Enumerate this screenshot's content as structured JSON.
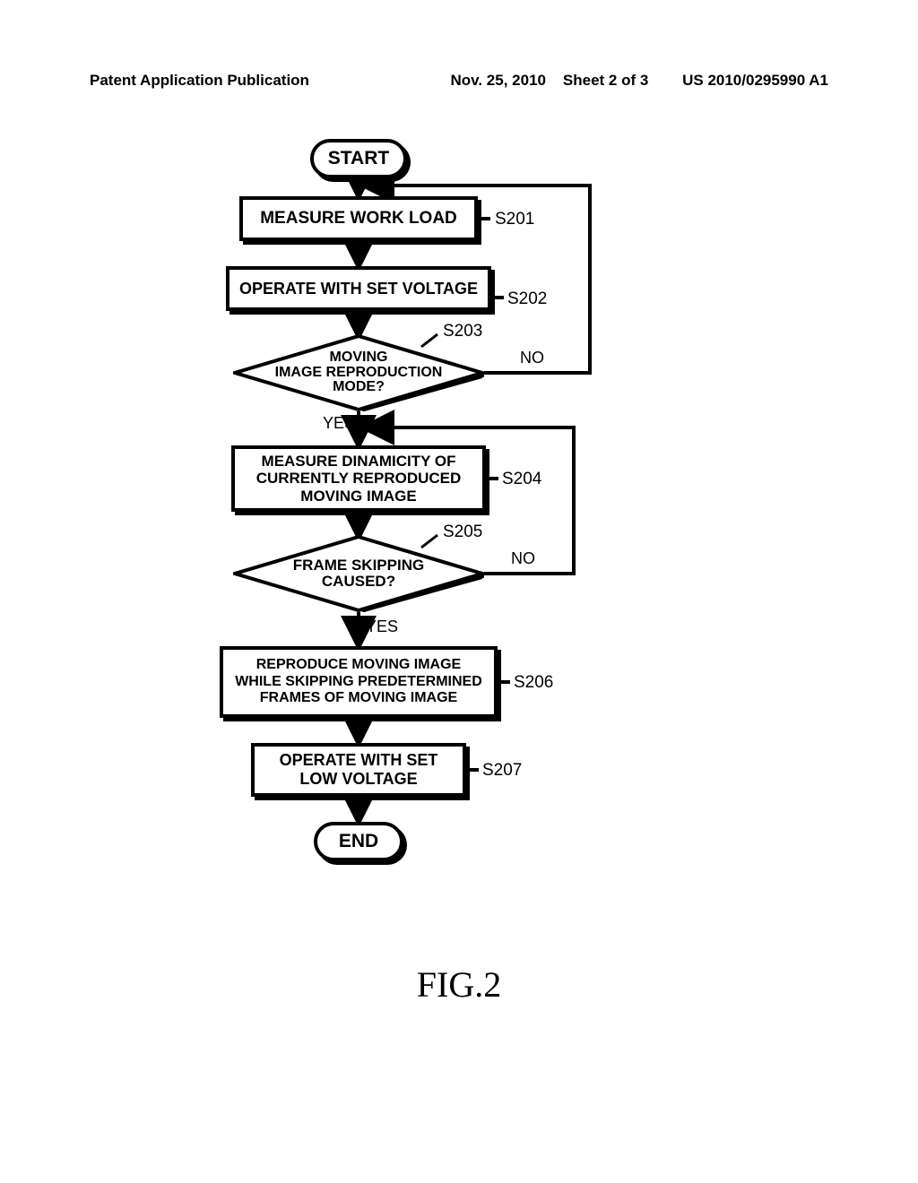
{
  "header": {
    "pub": "Patent Application Publication",
    "date": "Nov. 25, 2010",
    "sheet": "Sheet 2 of 3",
    "docno": "US 2010/0295990 A1"
  },
  "terminals": {
    "start": "START",
    "end": "END"
  },
  "steps": {
    "s201": "MEASURE WORK LOAD",
    "s202": "OPERATE WITH SET VOLTAGE",
    "s203": "MOVING\nIMAGE REPRODUCTION\nMODE?",
    "s204": "MEASURE DINAMICITY OF\nCURRENTLY REPRODUCED\nMOVING IMAGE",
    "s205": "FRAME SKIPPING\nCAUSED?",
    "s206": "REPRODUCE MOVING IMAGE\nWHILE SKIPPING PREDETERMINED\nFRAMES OF MOVING IMAGE",
    "s207": "OPERATE WITH SET\nLOW VOLTAGE"
  },
  "refs": {
    "s201": "S201",
    "s202": "S202",
    "s203": "S203",
    "s204": "S204",
    "s205": "S205",
    "s206": "S206",
    "s207": "S207"
  },
  "branches": {
    "yes": "YES",
    "no": "NO"
  },
  "figure_caption": "FIG.2"
}
